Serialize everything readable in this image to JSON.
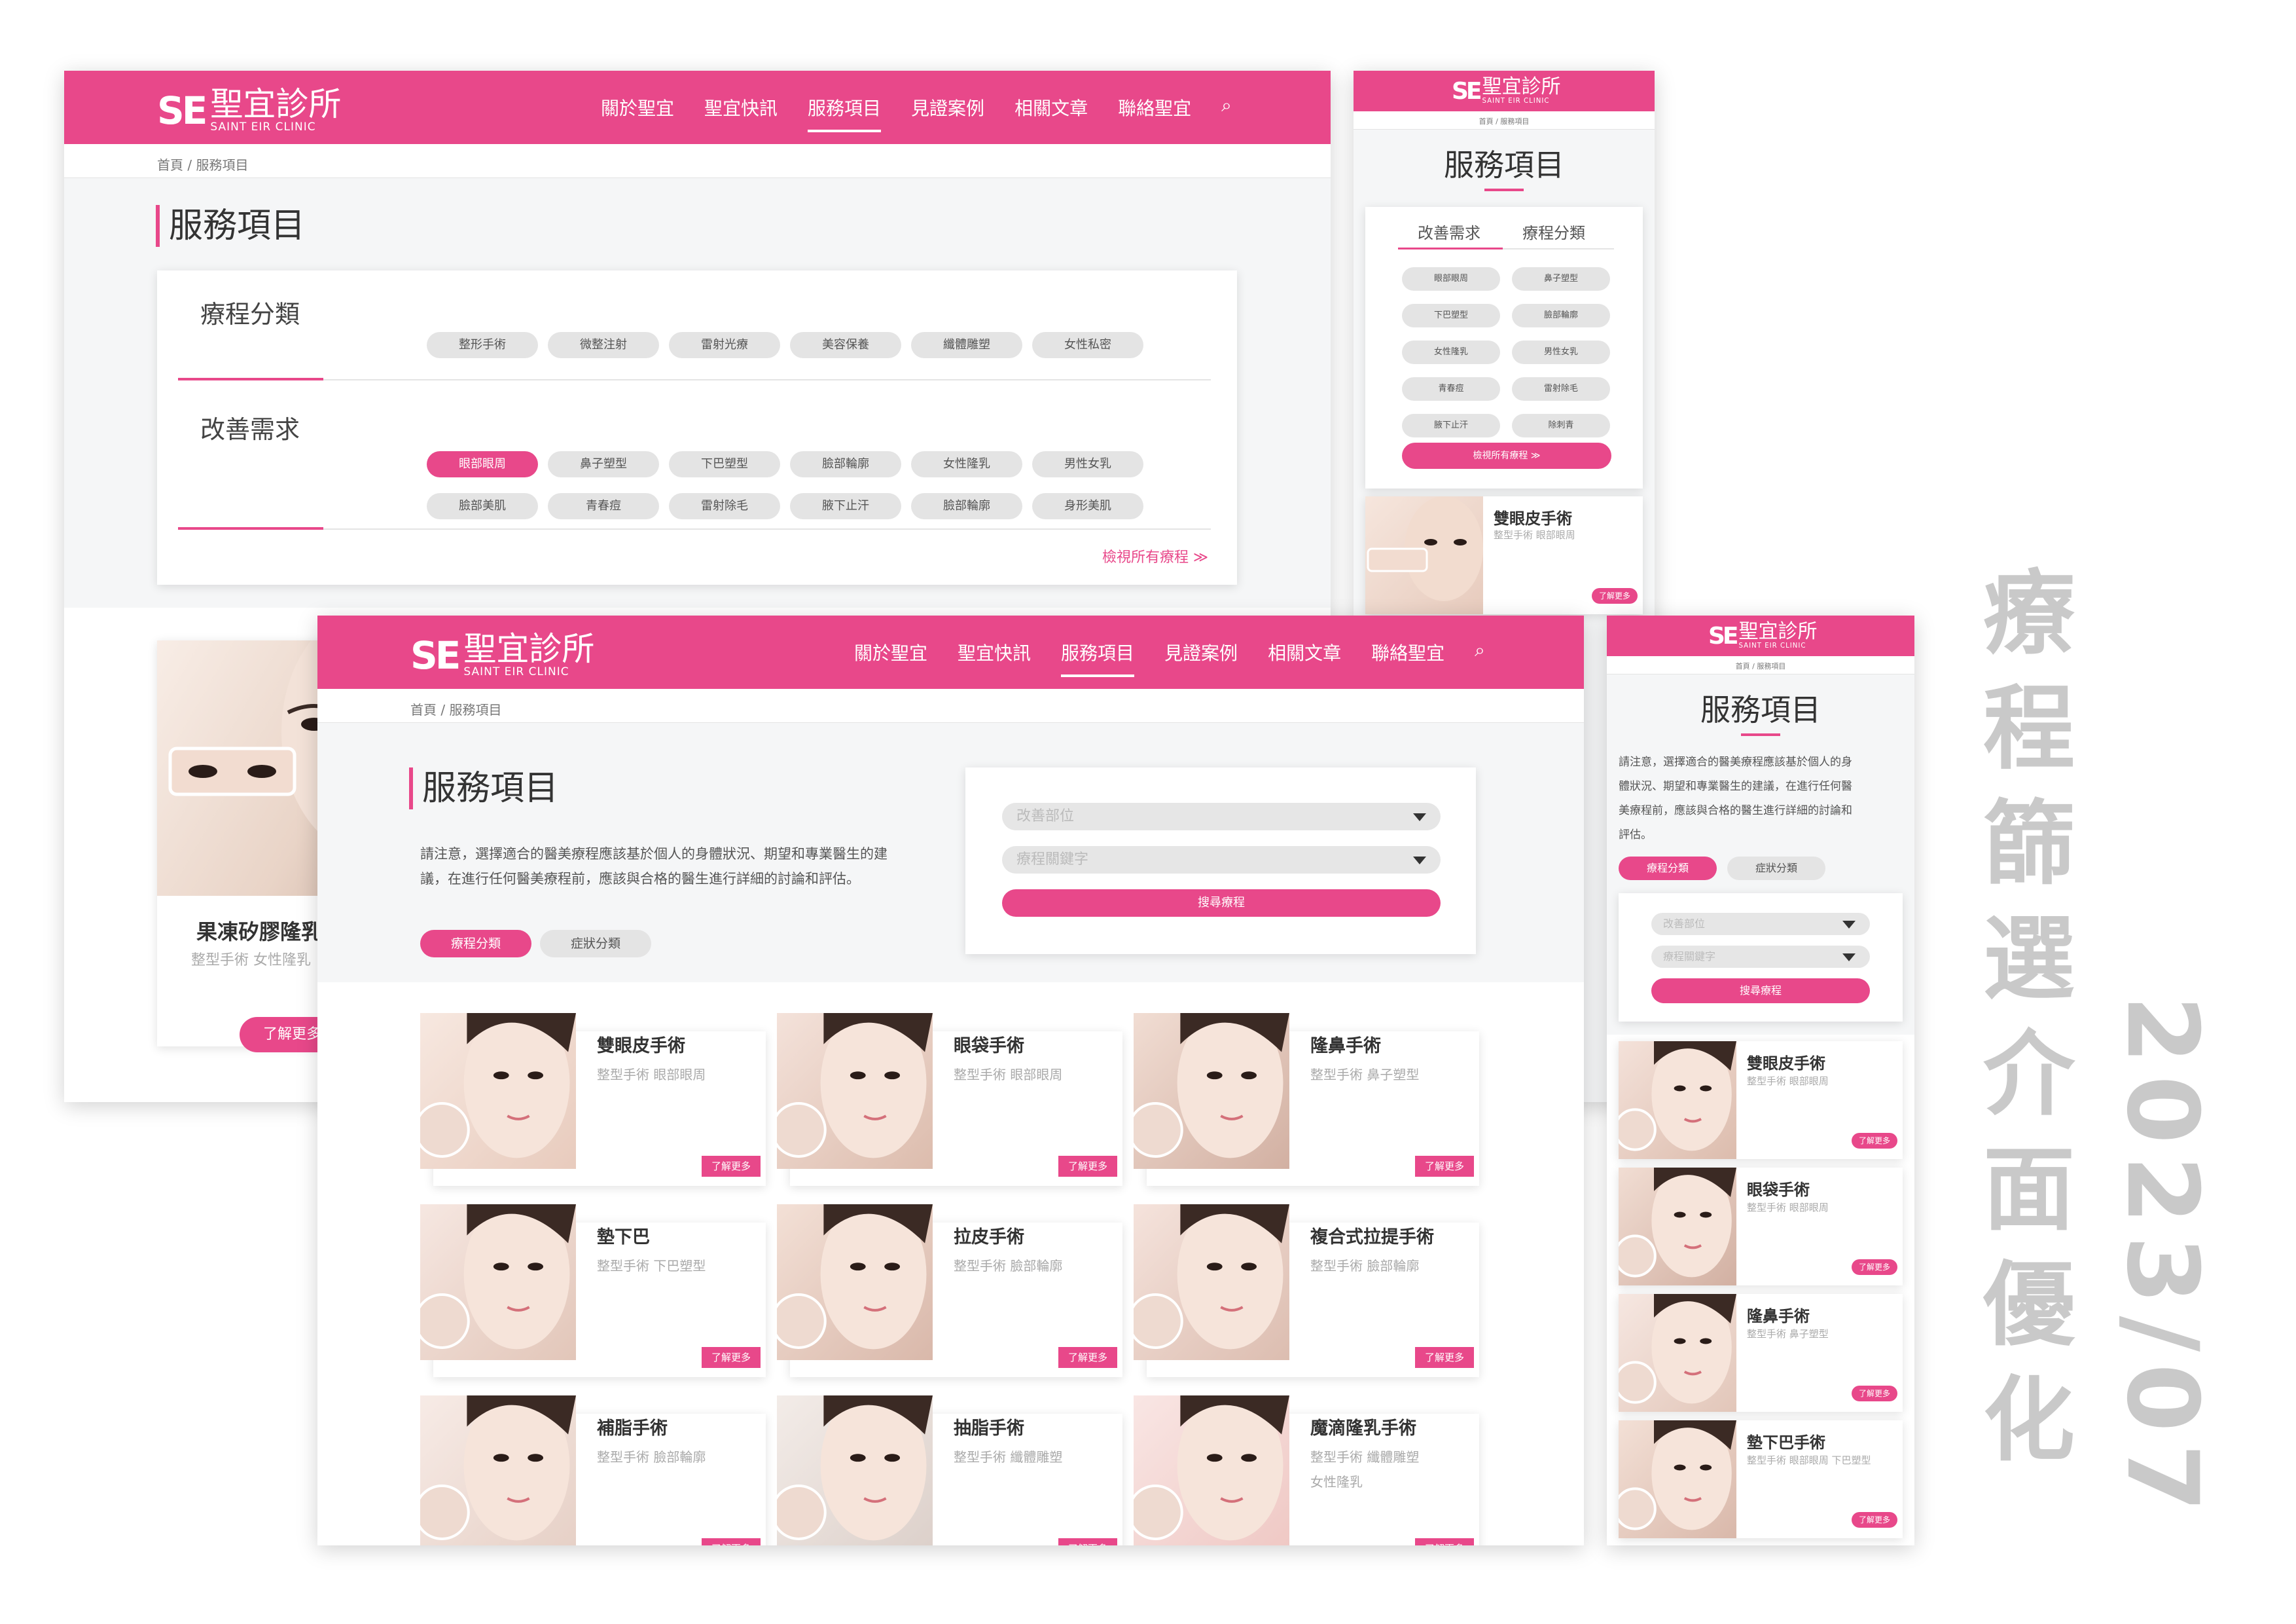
{
  "brand": {
    "mark": "SE",
    "name": "聖宜診所",
    "en": "SAINT EIR CLINIC"
  },
  "nav": [
    "關於聖宜",
    "聖宜快訊",
    "服務項目",
    "見證案例",
    "相關文章",
    "聯絡聖宜"
  ],
  "crumb": "首頁 / 服務項目",
  "crumb_short": "首頁 / 服務項目",
  "page_title": "服務項目",
  "colors": {
    "accent": "#e8488a"
  },
  "filter_panel": {
    "cat_title": "療程分類",
    "cat_pills": [
      "整形手術",
      "微整注射",
      "雷射光療",
      "美容保養",
      "纖體雕塑",
      "女性私密"
    ],
    "need_title": "改善需求",
    "need_pills_row1": [
      "眼部眼周",
      "鼻子塑型",
      "下巴塑型",
      "臉部輪廓",
      "女性隆乳",
      "男性女乳"
    ],
    "need_pills_row2": [
      "臉部美肌",
      "青春痘",
      "雷射除毛",
      "腋下止汗",
      "臉部輪廓",
      "身形美肌"
    ],
    "view_all": "檢視所有療程 ≫"
  },
  "partial_card": {
    "title": "果凍矽膠隆乳",
    "sub": "整型手術 女性隆乳",
    "more": "了解更多"
  },
  "m1": {
    "tabs": [
      "改善需求",
      "療程分類"
    ],
    "pills": [
      "眼部眼周",
      "鼻子塑型",
      "下巴塑型",
      "臉部輪廓",
      "女性隆乳",
      "男性女乳",
      "青春痘",
      "雷射除毛",
      "腋下止汗",
      "除刺青"
    ],
    "view_all": "檢視所有療程 ≫",
    "card": {
      "title": "雙眼皮手術",
      "sub": "整型手術 眼部眼周",
      "more": "了解更多"
    }
  },
  "notice": "請注意，選擇適合的醫美療程應該基於個人的身體狀況、期望和專業醫生的建議，在進行任何醫美療程前，應該與合格的醫生進行詳細的討論和評估。",
  "notice_l1": "請注意，選擇適合的醫美療程應該基於個人的身體狀況、期望和專業醫生的建",
  "notice_l2": "議，在進行任何醫美療程前，應該與合格的醫生進行詳細的討論和評估。",
  "m2_notice": [
    "請注意，選擇適合的醫美療程應該基於個人的身",
    "體狀況、期望和專業醫生的建議，在進行任何醫",
    "美療程前，應該與合格的醫生進行詳細的討論和",
    "評估。"
  ],
  "tabs2": [
    "療程分類",
    "症狀分類"
  ],
  "search": {
    "ph1": "改善部位",
    "ph2": "療程關鍵字",
    "btn": "搜尋療程"
  },
  "cards": [
    {
      "title": "雙眼皮手術",
      "sub": "整型手術 眼部眼周",
      "sub2": ""
    },
    {
      "title": "眼袋手術",
      "sub": "整型手術 眼部眼周",
      "sub2": ""
    },
    {
      "title": "隆鼻手術",
      "sub": "整型手術 鼻子塑型",
      "sub2": ""
    },
    {
      "title": "墊下巴",
      "sub": "整型手術 下巴塑型",
      "sub2": ""
    },
    {
      "title": "拉皮手術",
      "sub": "整型手術 臉部輪廓",
      "sub2": ""
    },
    {
      "title": "複合式拉提手術",
      "sub": "整型手術 臉部輪廓",
      "sub2": ""
    },
    {
      "title": "補脂手術",
      "sub": "整型手術 臉部輪廓",
      "sub2": ""
    },
    {
      "title": "抽脂手術",
      "sub": "整型手術 纖體雕塑",
      "sub2": ""
    },
    {
      "title": "魔滴隆乳手術",
      "sub": "整型手術 纖體雕塑",
      "sub2": "女性隆乳"
    }
  ],
  "more": "了解更多",
  "m2_cards": [
    {
      "title": "雙眼皮手術",
      "sub": "整型手術 眼部眼周"
    },
    {
      "title": "眼袋手術",
      "sub": "整型手術 眼部眼周"
    },
    {
      "title": "隆鼻手術",
      "sub": "整型手術 鼻子塑型"
    },
    {
      "title": "墊下巴手術",
      "sub": "整型手術 眼部眼周 下巴塑型"
    }
  ],
  "side": {
    "title": "療程篩選介面優化",
    "date": "2023/07"
  }
}
